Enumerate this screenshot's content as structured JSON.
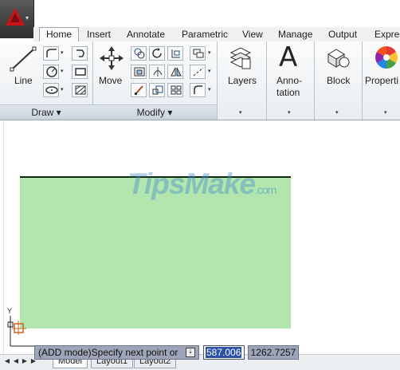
{
  "app": {
    "menu_drop_glyph": "▾"
  },
  "tabs": [
    "Home",
    "Insert",
    "Annotate",
    "Parametric",
    "View",
    "Manage",
    "Output",
    "Expres"
  ],
  "ribbon": {
    "draw_panel": {
      "title": "Draw ▾",
      "line_label": "Line"
    },
    "modify_panel": {
      "title": "Modify ▾",
      "move_label": "Move"
    },
    "layers_label": "Layers",
    "annotation_label_1": "Anno-",
    "annotation_label_2": "tation",
    "annotation_glyph": "A",
    "block_label": "Block",
    "properties_label": "Properti",
    "panel_expand_glyph": "▾"
  },
  "canvas": {
    "watermark_main": "TipsMake",
    "watermark_suffix": ".com",
    "ucs_y_label": "Y",
    "shape_color": "#b2e6ae"
  },
  "bottom_bar": {
    "nav_first": "◀",
    "nav_prev": "◀",
    "nav_next": "▶",
    "nav_last": "▶",
    "layout_tabs": [
      "Model",
      "Layout1",
      "Layout2"
    ]
  },
  "command": {
    "prompt": "(ADD mode)Specify next point or",
    "indicator": "⇣",
    "input_value": "587.006",
    "coord_value": "1262.7257"
  }
}
